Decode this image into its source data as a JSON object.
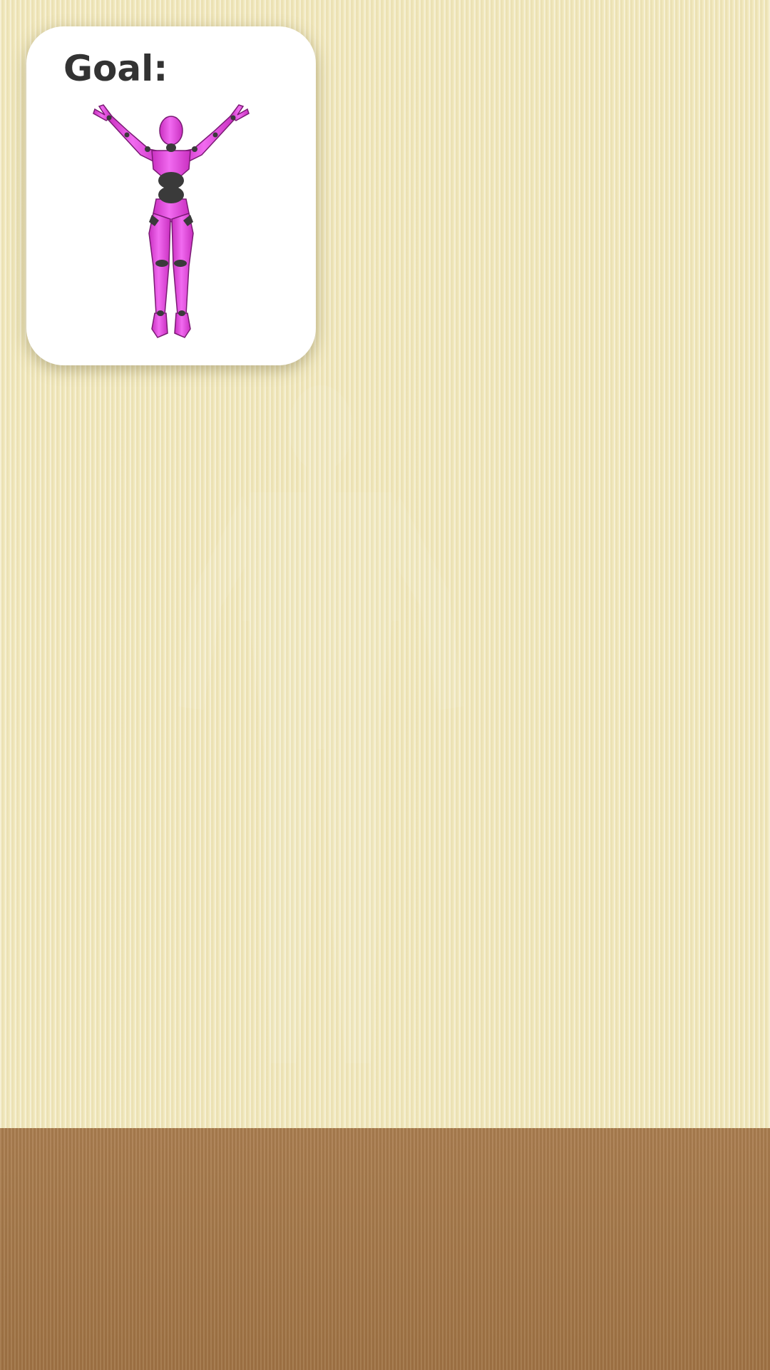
{
  "goal_card": {
    "title": "Goal:",
    "figure_icon": "pink-mannequin-arms-raised-icon"
  },
  "scene": {
    "wall_color": "#f1e8bd",
    "floor_color": "#a77949",
    "figure_color": "#e84fe0",
    "joint_color": "#3a3a3a"
  }
}
